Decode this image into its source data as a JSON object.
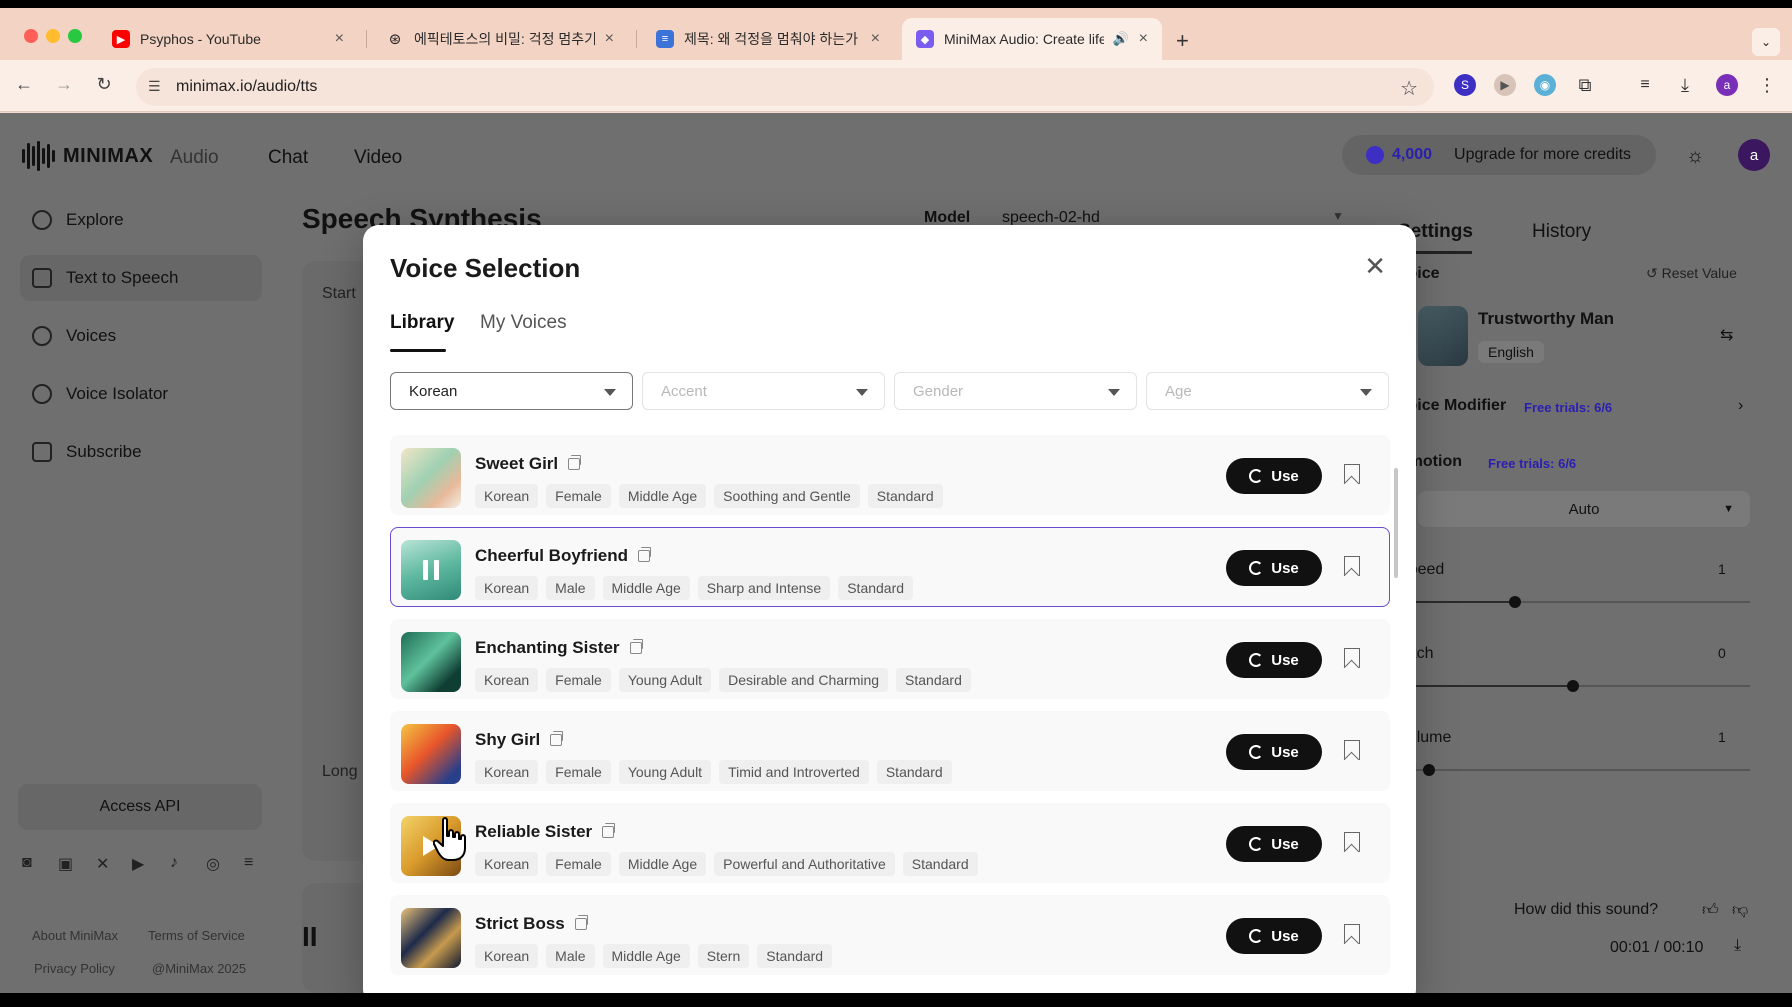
{
  "browser": {
    "tabs": [
      {
        "title": "Psyphos - YouTube",
        "close": "×"
      },
      {
        "title": "에픽테토스의 비밀: 걱정 멈추기 - C",
        "close": "×"
      },
      {
        "title": "제목: 왜 걱정을 멈춰야 하는가 - G",
        "close": "×"
      },
      {
        "title": "MiniMax Audio: Create life",
        "close": "×"
      }
    ],
    "new_tab": "+",
    "url": "minimax.io/audio/tts"
  },
  "app": {
    "brand": "MINIMAX",
    "nav": {
      "audio": "Audio",
      "chat": "Chat",
      "video": "Video"
    },
    "credits": "4,000",
    "upgrade": "Upgrade for more credits",
    "avatar": "a"
  },
  "sidebar": {
    "items": [
      {
        "label": "Explore"
      },
      {
        "label": "Text to Speech"
      },
      {
        "label": "Voices"
      },
      {
        "label": "Voice Isolator"
      },
      {
        "label": "Subscribe"
      }
    ],
    "access_api": "Access API",
    "footer": {
      "about": "About MiniMax",
      "terms": "Terms of Service",
      "privacy": "Privacy Policy",
      "copyright": "@MiniMax 2025"
    }
  },
  "main": {
    "title": "Speech Synthesis",
    "model_label": "Model",
    "model_value": "speech-02-hd",
    "start_hint": "Start",
    "long_hint": "Long"
  },
  "right_panel": {
    "tab_settings": "Settings",
    "tab_history": "History",
    "voice_label": "Voice",
    "reset": "Reset Value",
    "voice_name": "Trustworthy Man",
    "voice_lang": "English",
    "voice_modifier": "Voice Modifier",
    "modifier_trials": "Free trials: 6/6",
    "emotion": "Emotion",
    "emotion_trials": "Free trials: 6/6",
    "emotion_value": "Auto",
    "speed": "Speed",
    "speed_value": "1",
    "pitch": "Pitch",
    "pitch_value": "0",
    "volume": "Volume",
    "volume_value": "1",
    "feedback": "How did this sound?",
    "time": "00:01 / 00:10"
  },
  "modal": {
    "title": "Voice Selection",
    "tabs": {
      "library": "Library",
      "my_voices": "My Voices"
    },
    "filters": {
      "language": "Korean",
      "accent": "Accent",
      "gender": "Gender",
      "age": "Age"
    },
    "use_label": "Use",
    "voices": [
      {
        "name": "Sweet Girl",
        "tags": [
          "Korean",
          "Female",
          "Middle Age",
          "Soothing and Gentle",
          "Standard"
        ],
        "playing": false
      },
      {
        "name": "Cheerful Boyfriend",
        "tags": [
          "Korean",
          "Male",
          "Middle Age",
          "Sharp and Intense",
          "Standard"
        ],
        "playing": true
      },
      {
        "name": "Enchanting Sister",
        "tags": [
          "Korean",
          "Female",
          "Young Adult",
          "Desirable and Charming",
          "Standard"
        ],
        "playing": false
      },
      {
        "name": "Shy Girl",
        "tags": [
          "Korean",
          "Female",
          "Young Adult",
          "Timid and Introverted",
          "Standard"
        ],
        "playing": false
      },
      {
        "name": "Reliable Sister",
        "tags": [
          "Korean",
          "Female",
          "Middle Age",
          "Powerful and Authoritative",
          "Standard"
        ],
        "playing": false
      },
      {
        "name": "Strict Boss",
        "tags": [
          "Korean",
          "Male",
          "Middle Age",
          "Stern",
          "Standard"
        ],
        "playing": false
      }
    ]
  },
  "colors": {
    "accent": "#6b4bcf",
    "use_button": "#111111"
  }
}
